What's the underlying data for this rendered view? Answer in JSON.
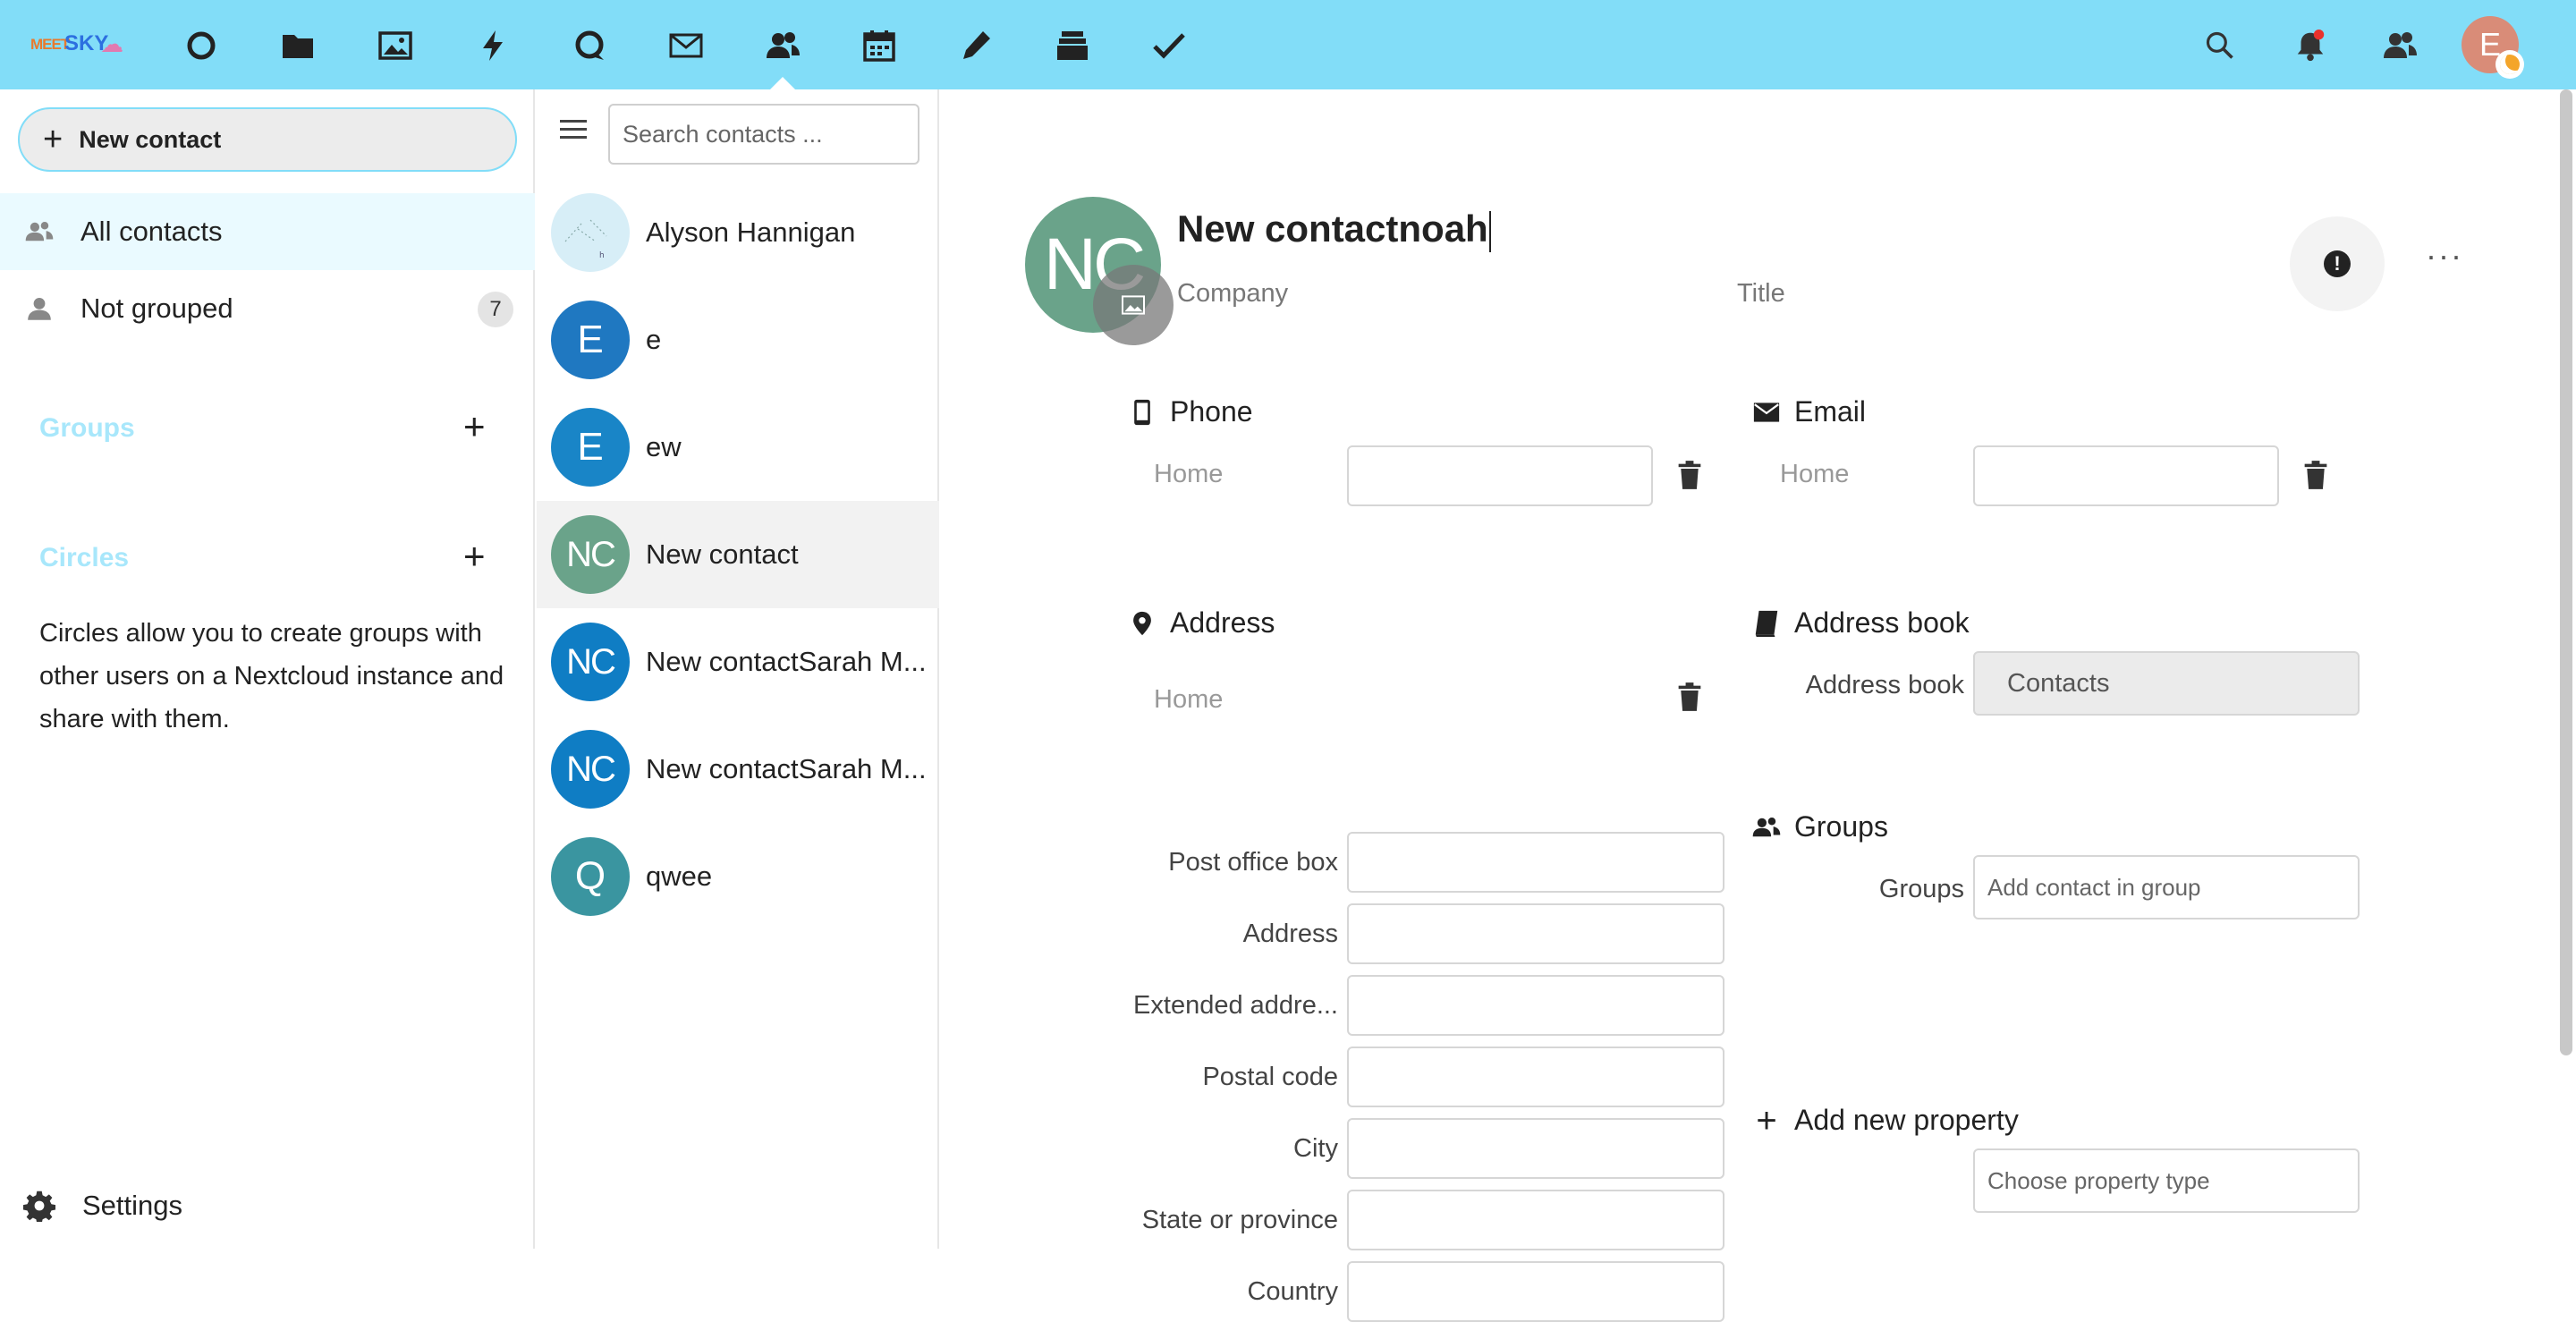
{
  "header": {
    "logo_text_1": "MEET",
    "logo_text_2": "SKY",
    "apps": [
      "dashboard-icon",
      "files-icon",
      "photos-icon",
      "activity-icon",
      "talk-icon",
      "mail-icon",
      "contacts-icon",
      "calendar-icon",
      "notes-icon",
      "deck-icon",
      "tasks-icon"
    ],
    "avatar_letter": "E"
  },
  "nav": {
    "new_contact": "New contact",
    "all_contacts": "All contacts",
    "not_grouped": "Not grouped",
    "not_grouped_count": "7",
    "groups_caption": "Groups",
    "circles_caption": "Circles",
    "circles_desc": "Circles allow you to create groups with other users on a Nextcloud instance and share with them.",
    "settings": "Settings"
  },
  "list": {
    "search_placeholder": "Search contacts ...",
    "contacts": [
      {
        "initials": "",
        "name": "Alyson Hannigan",
        "color": "#d7eef7"
      },
      {
        "initials": "E",
        "name": "e",
        "color": "#1f78c1"
      },
      {
        "initials": "E",
        "name": "ew",
        "color": "#1985c7"
      },
      {
        "initials": "NC",
        "name": "New contact",
        "color": "#6aa38a"
      },
      {
        "initials": "NC",
        "name": "New contactSarah M...",
        "color": "#0f7dc4"
      },
      {
        "initials": "NC",
        "name": "New contactSarah M...",
        "color": "#0f7dc4"
      },
      {
        "initials": "Q",
        "name": "qwee",
        "color": "#3a95a0"
      }
    ]
  },
  "detail": {
    "initials": "NC",
    "name": "New contactnoah",
    "company_placeholder": "Company",
    "title_placeholder": "Title",
    "phone": {
      "header": "Phone",
      "type": "Home"
    },
    "email": {
      "header": "Email",
      "type": "Home"
    },
    "address": {
      "header": "Address",
      "type": "Home",
      "fields": [
        "Post office box",
        "Address",
        "Extended addre...",
        "Postal code",
        "City",
        "State or province",
        "Country"
      ]
    },
    "addressbook": {
      "header": "Address book",
      "label": "Address book",
      "value": "Contacts"
    },
    "groups": {
      "header": "Groups",
      "label": "Groups",
      "placeholder": "Add contact in group"
    },
    "add_property": {
      "header": "Add new property",
      "placeholder": "Choose property type"
    }
  }
}
